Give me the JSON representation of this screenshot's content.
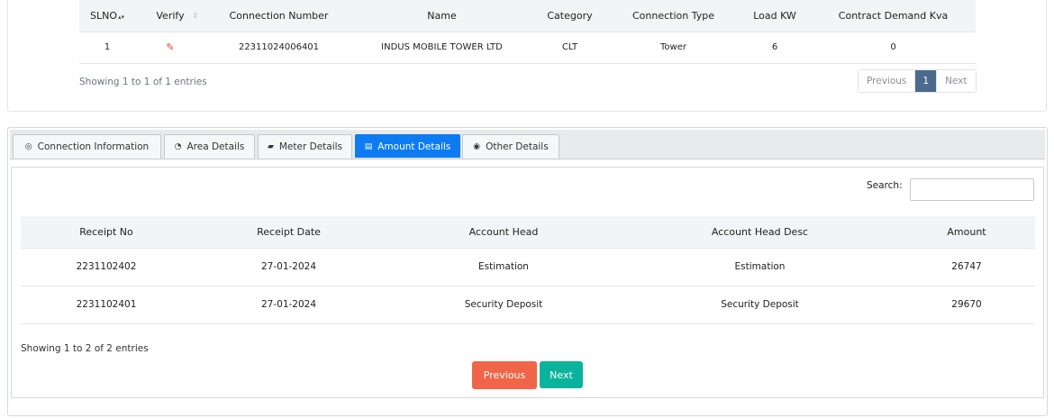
{
  "top": {
    "columns": [
      "SLNO",
      "Verify",
      "Connection Number",
      "Name",
      "Category",
      "Connection Type",
      "Load KW",
      "Contract Demand Kva"
    ],
    "row": {
      "slno": "1",
      "connection_number": "22311024006401",
      "name": "INDUS MOBILE TOWER LTD",
      "category": "CLT",
      "connection_type": "Tower",
      "load_kw": "6",
      "contract_demand": "0"
    },
    "info": "Showing 1 to 1 of 1 entries",
    "pager": {
      "previous": "Previous",
      "current": "1",
      "next": "Next"
    }
  },
  "tabs": [
    {
      "label": "Connection Information",
      "icon": "settings-icon"
    },
    {
      "label": "Area Details",
      "icon": "pie-chart-icon"
    },
    {
      "label": "Meter Details",
      "icon": "bar-chart-icon"
    },
    {
      "label": "Amount Details",
      "icon": "receipt-icon",
      "active": true
    },
    {
      "label": "Other Details",
      "icon": "gear-icon"
    }
  ],
  "amount": {
    "search_label": "Search:",
    "search_value": "",
    "columns": [
      "Receipt No",
      "Receipt Date",
      "Account Head",
      "Account Head Desc",
      "Amount"
    ],
    "rows": [
      [
        "2231102402",
        "27-01-2024",
        "Estimation",
        "Estimation",
        "26747"
      ],
      [
        "2231102401",
        "27-01-2024",
        "Security Deposit",
        "Security Deposit",
        "29670"
      ]
    ],
    "info": "Showing 1 to 2 of 2 entries",
    "previous": "Previous",
    "next": "Next"
  },
  "colors": {
    "active_tab": "#0d7bf2",
    "previous_button": "#f06548",
    "next_button": "#0ab39c",
    "page_active": "#4b6a8c",
    "verify_icon": "#e53935"
  }
}
